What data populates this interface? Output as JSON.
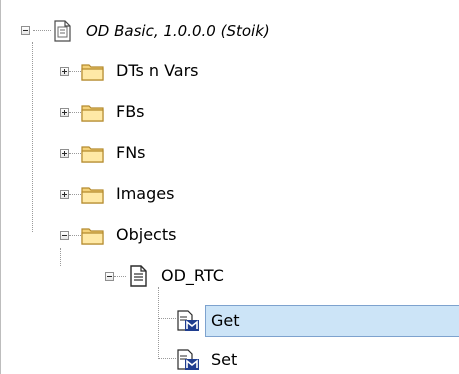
{
  "tree": {
    "root": {
      "label": "OD Basic, 1.0.0.0 (Stoik)",
      "expanded": true,
      "icon": "library-file-icon"
    },
    "folders": [
      {
        "label": "DTs n Vars",
        "expanded": false,
        "icon": "folder-icon"
      },
      {
        "label": "FBs",
        "expanded": false,
        "icon": "folder-icon"
      },
      {
        "label": "FNs",
        "expanded": false,
        "icon": "folder-icon"
      },
      {
        "label": "Images",
        "expanded": false,
        "icon": "folder-icon"
      },
      {
        "label": "Objects",
        "expanded": true,
        "icon": "folder-icon"
      }
    ],
    "object": {
      "label": "OD_RTC",
      "expanded": true,
      "icon": "object-file-icon"
    },
    "methods": [
      {
        "label": "Get",
        "selected": true,
        "icon": "method-icon"
      },
      {
        "label": "Set",
        "selected": false,
        "icon": "method-icon"
      }
    ]
  },
  "colors": {
    "selection": "#cce4f7",
    "selection_border": "#7da2ce",
    "folder": "#f4d27a",
    "method_badge": "#1f3d8f"
  }
}
